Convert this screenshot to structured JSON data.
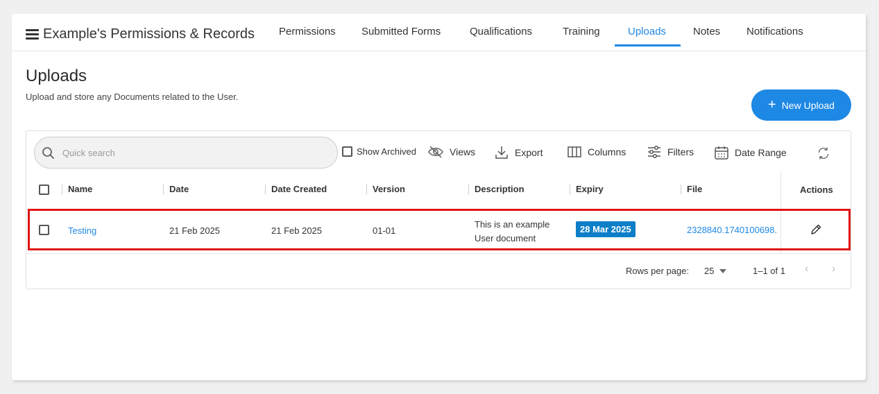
{
  "app": {
    "title": "Example's Permissions & Records"
  },
  "tabs": [
    {
      "label": "Permissions"
    },
    {
      "label": "Submitted Forms"
    },
    {
      "label": "Qualifications"
    },
    {
      "label": "Training"
    },
    {
      "label": "Uploads"
    },
    {
      "label": "Notes"
    },
    {
      "label": "Notifications"
    }
  ],
  "page": {
    "title": "Uploads",
    "subtitle": "Upload and store any Documents related to the User.",
    "new_button": "New Upload"
  },
  "toolbar": {
    "search_placeholder": "Quick search",
    "show_archived": "Show Archived",
    "views": "Views",
    "export": "Export",
    "columns": "Columns",
    "filters": "Filters",
    "date_range": "Date Range"
  },
  "table": {
    "headers": [
      "Name",
      "Date",
      "Date Created",
      "Version",
      "Description",
      "Expiry",
      "File",
      "Actions"
    ],
    "rows": [
      {
        "name": "Testing",
        "date": "21 Feb 2025",
        "date_created": "21 Feb 2025",
        "version": "01-01",
        "description": "This is an example User document",
        "expiry": "28 Mar 2025",
        "file": "2328840.1740100698."
      }
    ]
  },
  "pagination": {
    "rows_per_page_label": "Rows per page:",
    "rows_per_page": "25",
    "range": "1–1 of 1"
  },
  "colors": {
    "accent": "#1e88e5",
    "badge": "#0d7ec7",
    "highlight": "#e01414"
  }
}
